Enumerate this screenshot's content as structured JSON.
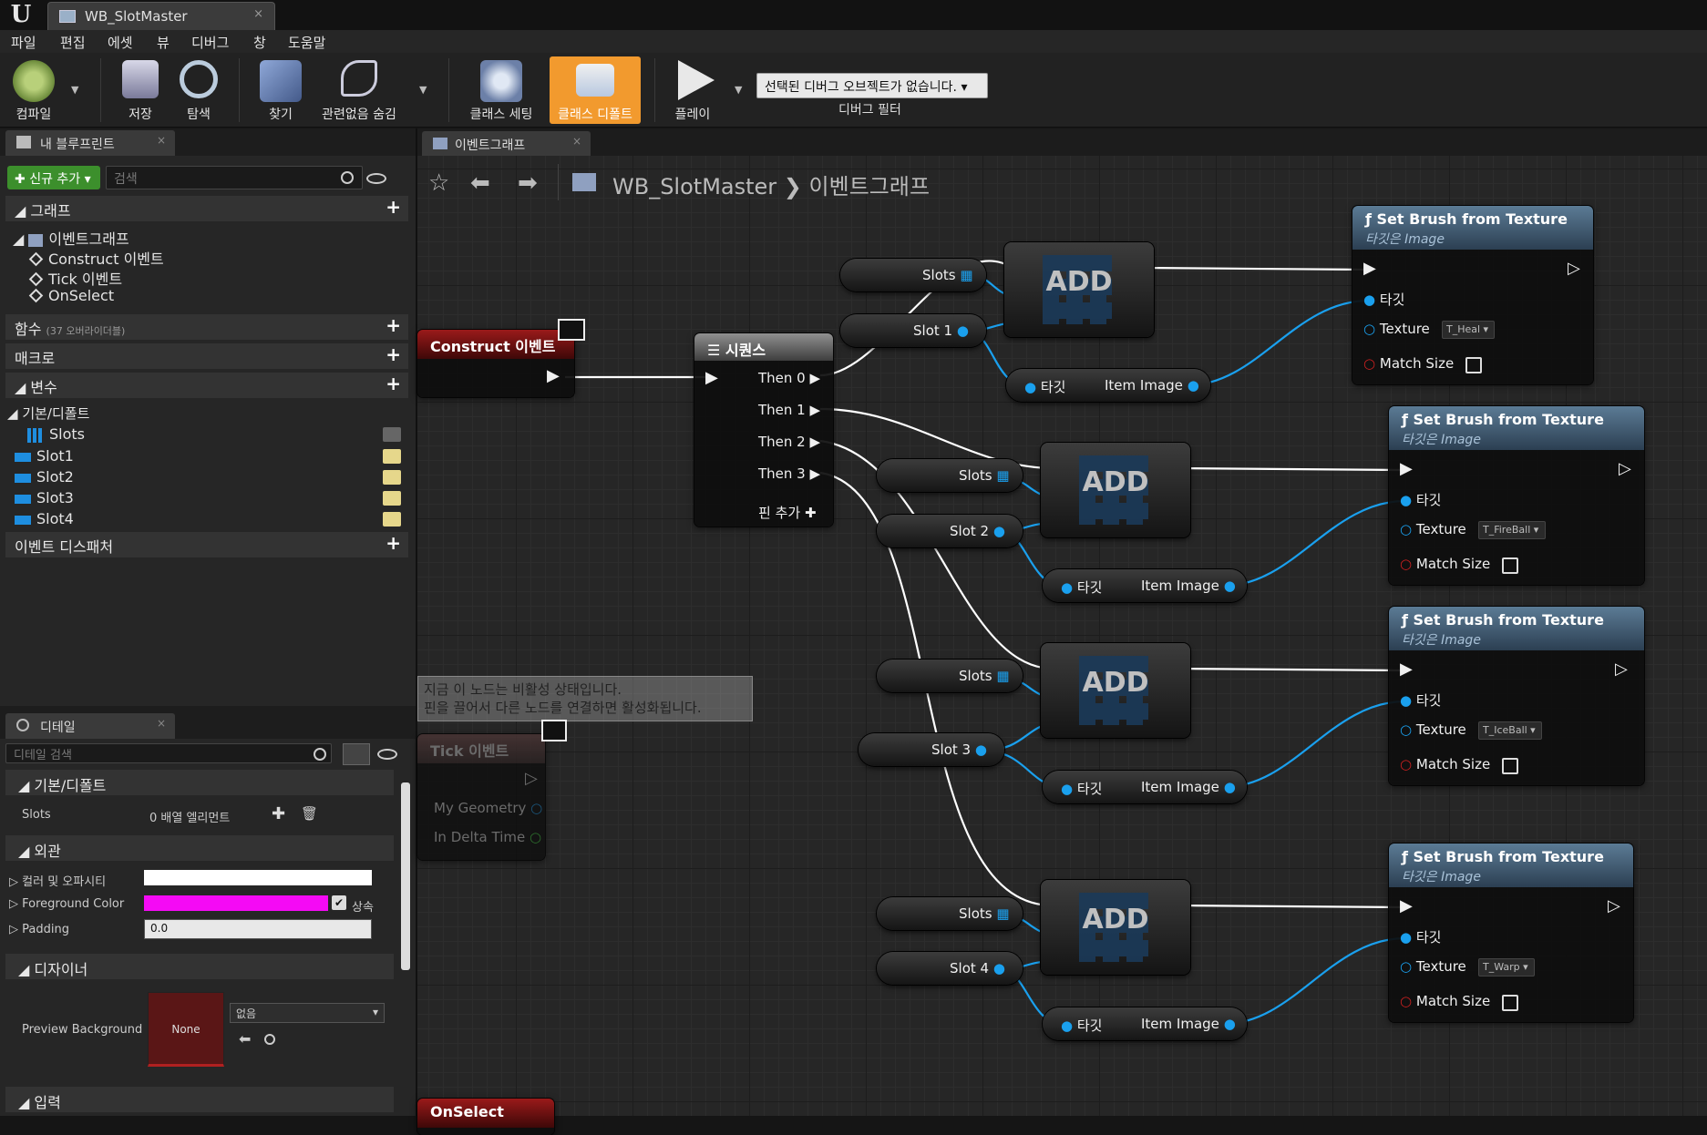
{
  "window": {
    "doc_tab": "WB_SlotMaster"
  },
  "menu": [
    "파일",
    "편집",
    "에셋",
    "뷰",
    "디버그",
    "창",
    "도움말"
  ],
  "toolbar": {
    "compile": "컴파일",
    "save": "저장",
    "browse": "탐색",
    "find": "찾기",
    "hide_unrelated": "관련없음 숨김",
    "class_settings": "클래스 세팅",
    "class_defaults": "클래스 디폴트",
    "play": "플레이",
    "debug_select": "선택된 디버그 오브젝트가 없습니다.",
    "debug_filter": "디버그 필터"
  },
  "my_blueprint": {
    "tab": "내 블루프린트",
    "add_new": "신규 추가",
    "search_placeholder": "검색",
    "graph_section": "그래프",
    "event_graph": "이벤트그래프",
    "events": [
      "Construct 이벤트",
      "Tick 이벤트",
      "OnSelect"
    ],
    "functions": "함수",
    "functions_sub": "(37 오버라이더블)",
    "macros": "매크로",
    "variables": "변수",
    "vars_category": "기본/디폴트",
    "vars": [
      "Slots",
      "Slot1",
      "Slot2",
      "Slot3",
      "Slot4"
    ],
    "event_dispatchers": "이벤트 디스패처"
  },
  "details": {
    "tab": "디테일",
    "search_placeholder": "디테일 검색",
    "sec_default": "기본/디폴트",
    "slots_label": "Slots",
    "slots_value": "0 배열 엘리먼트",
    "sec_appearance": "외관",
    "color_opacity": "컬러 및 오파시티",
    "foreground_color": "Foreground Color",
    "inherit": "상속",
    "padding": "Padding",
    "padding_value": "0.0",
    "sec_designer": "디자이너",
    "preview_bg": "Preview Background",
    "preview_none": "None",
    "preview_select": "없음",
    "sec_input": "입력"
  },
  "graph": {
    "tab": "이벤트그래프",
    "breadcrumb_root": "WB_SlotMaster",
    "breadcrumb_leaf": "이벤트그래프",
    "construct_event": "Construct 이벤트",
    "tick_event": "Tick 이벤트",
    "tick_pins": [
      "My Geometry",
      "In Delta Time"
    ],
    "onselect_event": "OnSelect",
    "sequence": "시퀀스",
    "then_pins": [
      "Then 0",
      "Then 1",
      "Then 2",
      "Then 3"
    ],
    "add_pin": "핀 추가",
    "comment_line1": "지금 이 노드는 비활성 상태입니다.",
    "comment_line2": "핀을 끌어서 다른 노드를 연결하면 활성화됩니다.",
    "add_label": "ADD",
    "slots_label": "Slots",
    "target_label": "타깃",
    "item_image": "Item Image",
    "slot_vars": [
      "Slot 1",
      "Slot 2",
      "Slot 3",
      "Slot 4"
    ],
    "set_brush": {
      "title": "Set Brush from Texture",
      "subtitle": "타깃은 Image",
      "texture_label": "Texture",
      "match_size": "Match Size",
      "textures": [
        "T_Heal",
        "T_FireBall",
        "T_IceBall",
        "T_Warp"
      ]
    }
  },
  "colors": {
    "exec": "#ffffff",
    "object_pin": "#1aa0ee",
    "float_pin": "#5fd35f",
    "accent": "#f29a2e",
    "event_header": "#8e1818"
  }
}
